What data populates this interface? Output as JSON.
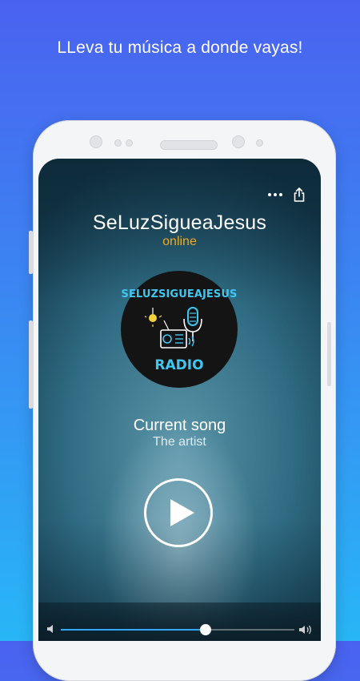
{
  "headline": "LLeva tu música a donde vayas!",
  "station": {
    "name": "SeLuzSigueaJesus",
    "status": "online",
    "logo_top_text": "SELUZSIGUEAJESUS",
    "logo_bottom_text": "RADIO"
  },
  "now_playing": {
    "song": "Current song",
    "artist": "The artist"
  },
  "volume": {
    "level": 0.62
  },
  "colors": {
    "accent": "#f2a81e",
    "slider": "#31a7ff",
    "logo_text": "#3fc6f1"
  },
  "icons": {
    "menu": "more-dots-icon",
    "share": "share-icon",
    "play": "play-icon",
    "volume_low": "volume-low-icon",
    "volume_high": "volume-high-icon"
  }
}
